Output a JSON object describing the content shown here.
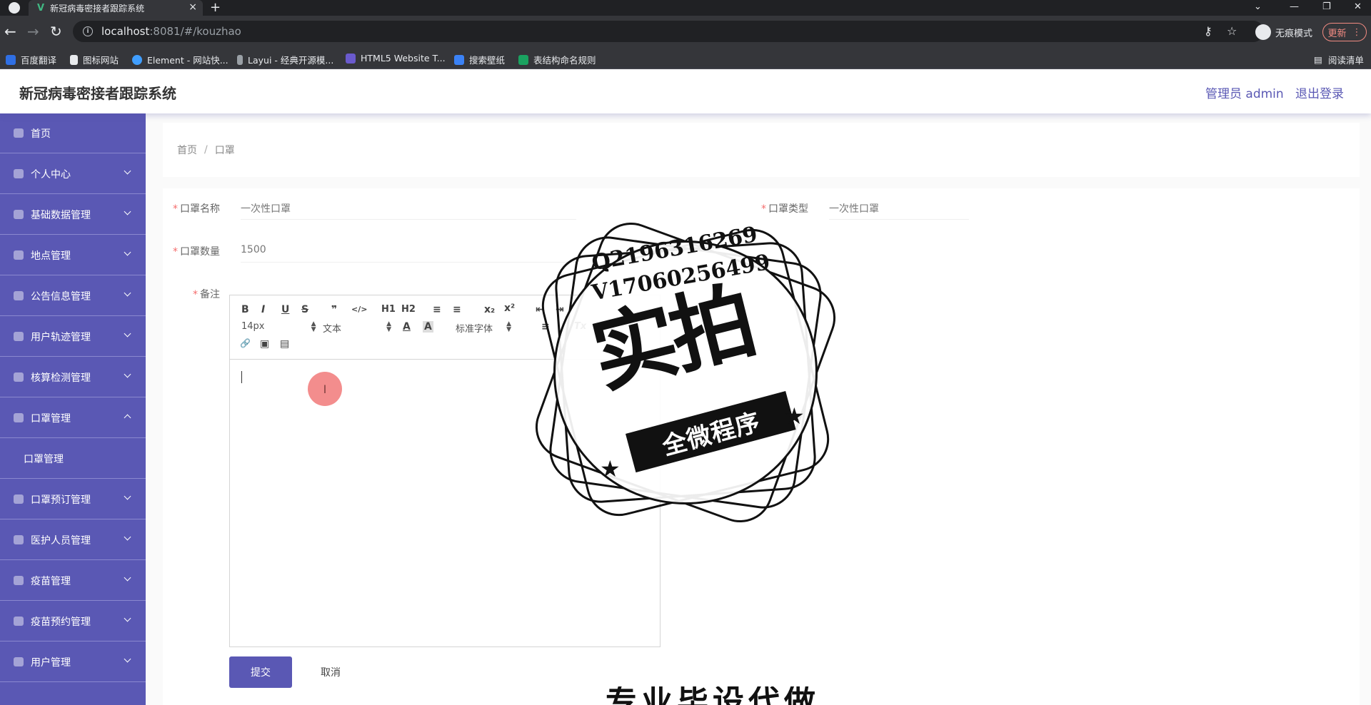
{
  "browser": {
    "tab_title": "新冠病毒密接者跟踪系统",
    "tab_logo": "V",
    "tab_close": "×",
    "new_tab": "+",
    "url_host": "localhost",
    "url_path": ":8081/#/kouzhao",
    "incognito_label": "无痕模式",
    "update_label": "更新",
    "reading_list": "阅读清单",
    "bookmarks": [
      {
        "label": "百度翻译",
        "color": "#2f6fe4"
      },
      {
        "label": "图标网站",
        "color": "#e8eaed"
      },
      {
        "label": "Element - 网站快...",
        "color": "#409eff"
      },
      {
        "label": "Layui - 经典开源模...",
        "color": "#9aa0a6"
      },
      {
        "label": "HTML5 Website T...",
        "color": "#6a5acd"
      },
      {
        "label": "搜索壁纸",
        "color": "#3b82f6"
      },
      {
        "label": "表结构命名规则",
        "color": "#1aa260"
      }
    ]
  },
  "header": {
    "title": "新冠病毒密接者跟踪系统",
    "user": "管理员 admin",
    "logout": "退出登录"
  },
  "sidebar": {
    "items": [
      {
        "label": "首页",
        "has_children": false
      },
      {
        "label": "个人中心",
        "has_children": true
      },
      {
        "label": "基础数据管理",
        "has_children": true
      },
      {
        "label": "地点管理",
        "has_children": true
      },
      {
        "label": "公告信息管理",
        "has_children": true
      },
      {
        "label": "用户轨迹管理",
        "has_children": true
      },
      {
        "label": "核算检测管理",
        "has_children": true
      },
      {
        "label": "口罩管理",
        "has_children": true,
        "expanded": true
      },
      {
        "label": "口罩预订管理",
        "has_children": true
      },
      {
        "label": "医护人员管理",
        "has_children": true
      },
      {
        "label": "疫苗管理",
        "has_children": true
      },
      {
        "label": "疫苗预约管理",
        "has_children": true
      },
      {
        "label": "用户管理",
        "has_children": true
      }
    ],
    "sub_item": "口罩管理"
  },
  "breadcrumb": {
    "home": "首页",
    "separator": "/",
    "current": "口罩"
  },
  "form": {
    "name_label": "口罩名称",
    "name_value": "一次性口罩",
    "type_label": "口罩类型",
    "type_value": "一次性口罩",
    "qty_label": "口罩数量",
    "qty_value": "1500",
    "remark_label": "备注",
    "required_mark": "*",
    "submit": "提交",
    "cancel": "取消"
  },
  "editor": {
    "toolbar_row1": [
      "B",
      "I",
      "U",
      "S",
      "❞",
      "</>",
      "H1",
      "H2",
      "≡",
      "≡",
      "x₂",
      "x²",
      "⇤",
      "⇥"
    ],
    "font_size": "14px",
    "header_select": "文本",
    "font_family": "标准字体",
    "color_icon": "A",
    "bg_icon": "A",
    "align_icon": "≡",
    "clear_icon": "Tx",
    "row3": [
      "🔗",
      "▣",
      "▤"
    ],
    "cursor_glyph": "I"
  },
  "watermark": {
    "line1": "Q2196316269",
    "line2": "V17060256499",
    "big": "实拍",
    "ribbon": "全微程序",
    "star": "★",
    "bottom": "专业毕设代做"
  },
  "colors": {
    "primary": "#5a58b4",
    "required": "#f56c6c"
  }
}
